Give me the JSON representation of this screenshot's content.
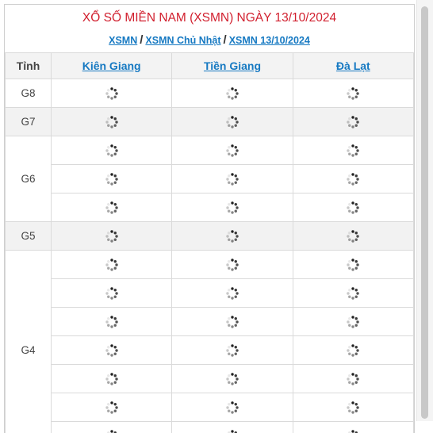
{
  "header": {
    "title": "XỔ SỐ MIỀN NAM (XSMN) NGÀY 13/10/2024",
    "breadcrumbs": [
      "XSMN",
      "XSMN Chủ Nhật",
      "XSMN 13/10/2024"
    ],
    "separator": "/"
  },
  "table": {
    "first_col_header": "Tỉnh",
    "provinces": [
      "Kiên Giang",
      "Tiền Giang",
      "Đà Lạt"
    ],
    "rows": [
      {
        "label": "G8",
        "count": 1,
        "shaded": false
      },
      {
        "label": "G7",
        "count": 1,
        "shaded": true
      },
      {
        "label": "G6",
        "count": 3,
        "shaded": false
      },
      {
        "label": "G5",
        "count": 1,
        "shaded": true
      },
      {
        "label": "G4",
        "count": 7,
        "shaded": false
      }
    ],
    "cell_state": "loading-spinner-icon"
  }
}
